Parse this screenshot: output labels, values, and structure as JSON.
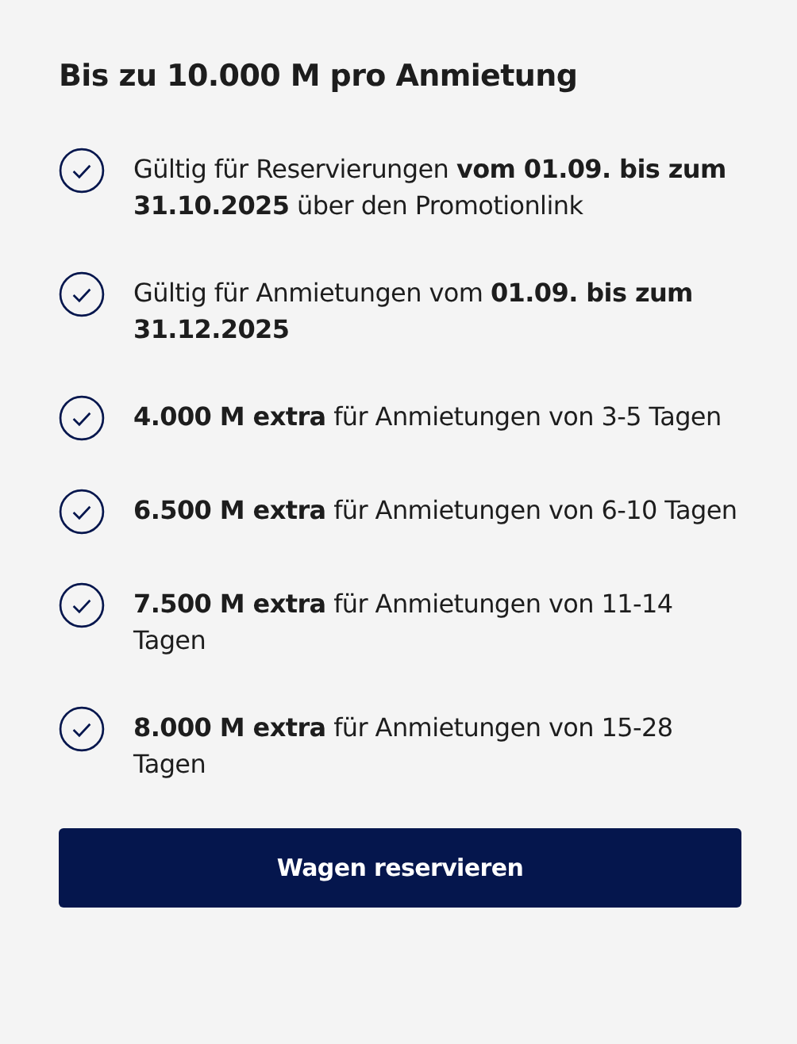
{
  "title": "Bis zu 10.000 M pro Anmietung",
  "benefits": [
    {
      "text": "Gültig für Reservierungen **vom 01.09. bis zum 31.10.2025** über den Promotionlink"
    },
    {
      "text": "Gültig für Anmietungen vom **01.09. bis zum 31.12.2025**"
    },
    {
      "text": "**4.000 M extra** für Anmietungen von 3-5 Tagen"
    },
    {
      "text": "**6.500 M extra** für Anmietungen von 6-10 Tagen"
    },
    {
      "text": "**7.500 M extra** für Anmietungen von 11-14 Tagen"
    },
    {
      "text": "**8.000 M extra** für Anmietungen von 15-28 Tagen"
    }
  ],
  "button": "Wagen reservieren"
}
